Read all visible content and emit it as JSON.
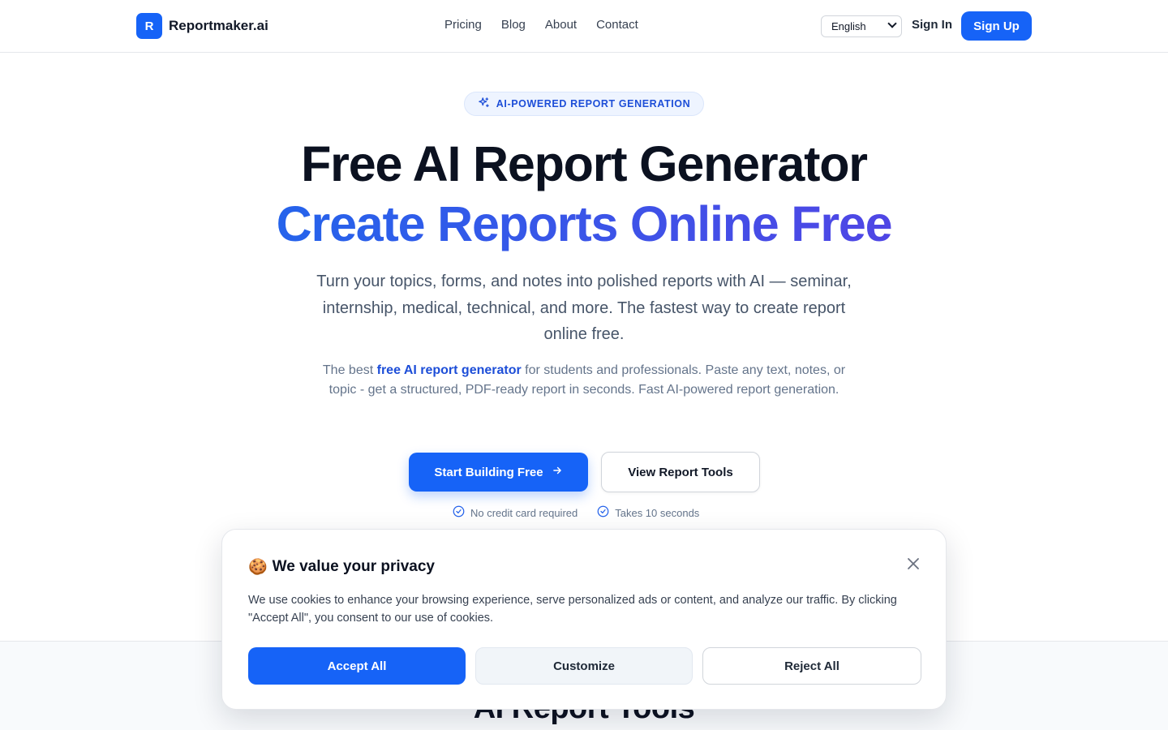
{
  "nav": {
    "logo_letter": "R",
    "brand": "Reportmaker.ai",
    "links": [
      "Pricing",
      "Blog",
      "About",
      "Contact"
    ],
    "language": "English",
    "sign_in": "Sign In",
    "sign_up": "Sign Up"
  },
  "hero": {
    "badge": "AI-POWERED REPORT GENERATION",
    "title_line1": "Free AI Report Generator",
    "title_line2": "Create Reports Online Free",
    "subtitle": "Turn your topics, forms, and notes into polished reports with AI — seminar, internship, medical, technical, and more. The fastest way to create report online free.",
    "desc_prefix": "The best ",
    "desc_highlight": "free AI report generator",
    "desc_suffix": " for students and professionals. Paste any text, notes, or topic - get a structured, PDF-ready report in seconds. Fast AI-powered report generation.",
    "primary_cta": "Start Building Free",
    "secondary_cta": "View Report Tools",
    "perks": [
      "No credit card required",
      "Takes 10 seconds"
    ]
  },
  "section": {
    "title": "AI Report Tools"
  },
  "cookie": {
    "emoji": "🍪",
    "title": "We value your privacy",
    "text": "We use cookies to enhance your browsing experience, serve personalized ads or content, and analyze our traffic. By clicking \"Accept All\", you consent to our use of cookies.",
    "accept": "Accept All",
    "customize": "Customize",
    "reject": "Reject All"
  },
  "colors": {
    "brand": "#1663f7",
    "gradient_start": "#2563eb",
    "gradient_end": "#4f46e5",
    "text_dark": "#0b1120"
  }
}
